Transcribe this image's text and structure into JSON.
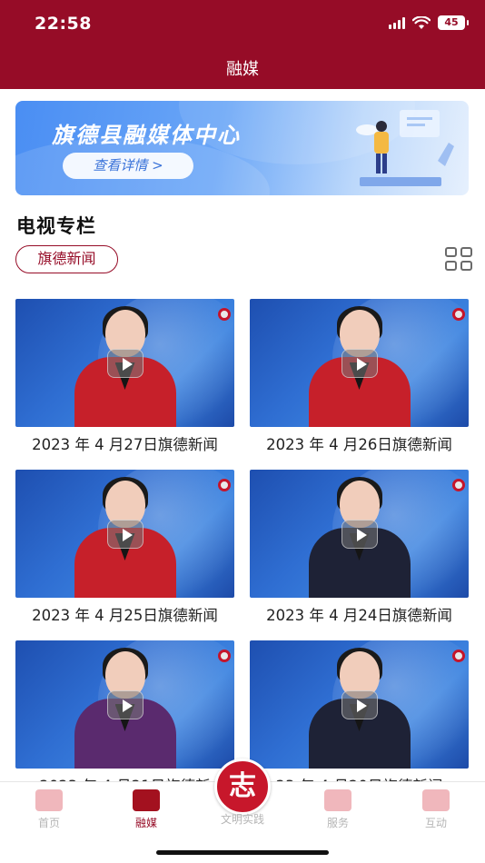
{
  "status_bar": {
    "time": "22:58",
    "battery": "45"
  },
  "nav": {
    "title": "融媒"
  },
  "banner": {
    "title": "旗德县融媒体中心",
    "button_label": "查看详情 >"
  },
  "section": {
    "title": "电视专栏",
    "tag_label": "旗德新闻"
  },
  "videos": [
    {
      "caption": "2023 年 4 月27日旗德新闻",
      "suit_color": "#c6202a"
    },
    {
      "caption": "2023 年 4 月26日旗德新闻",
      "suit_color": "#c6202a"
    },
    {
      "caption": "2023 年 4 月25日旗德新闻",
      "suit_color": "#c6202a"
    },
    {
      "caption": "2023 年 4 月24日旗德新闻",
      "suit_color": "#1e2236"
    },
    {
      "caption": "2023 年 4 月21日旗德新",
      "suit_color": "#5a2a6e"
    },
    {
      "caption": "23 年 4 月20日旗德新闻",
      "suit_color": "#1e2236"
    }
  ],
  "tabbar": {
    "tabs": [
      {
        "label": "首页",
        "icon": "home-icon"
      },
      {
        "label": "融媒",
        "icon": "video-camera-icon"
      },
      {
        "label": "服务",
        "icon": "service-box-icon"
      },
      {
        "label": "互动",
        "icon": "chat-bubble-icon"
      }
    ],
    "center": {
      "label": "文明实践",
      "badge": "志"
    }
  },
  "colors": {
    "brand": "#960c27",
    "tab_inactive": "#b6b6b6"
  }
}
